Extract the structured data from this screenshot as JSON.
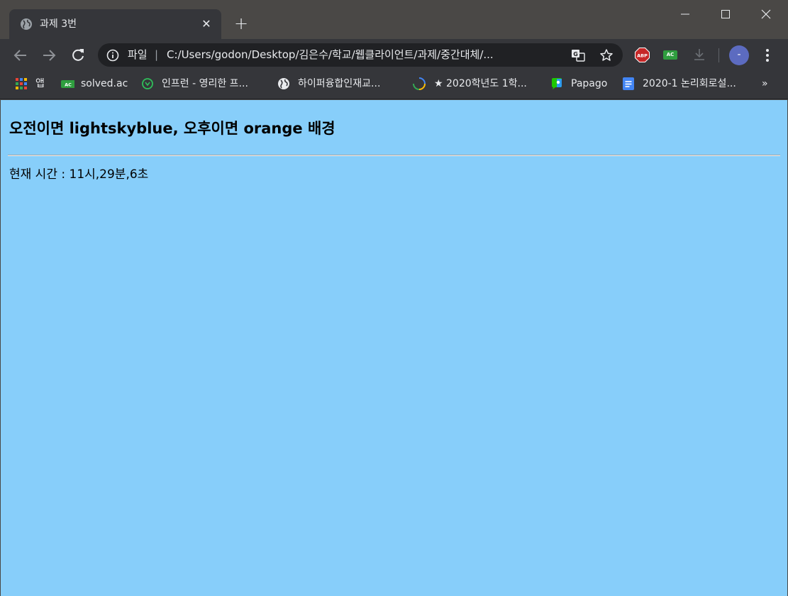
{
  "tab": {
    "title": "과제 3번",
    "close": "✕"
  },
  "new_tab_label": "+",
  "omnibox": {
    "scheme_label": "파일",
    "separator": "|",
    "url": "C:/Users/godon/Desktop/김은수/학교/웹클라이언트/과제/중간대체/..."
  },
  "extensions": {
    "ac_label": "AC",
    "abp_label": "ABP"
  },
  "avatar_label": "-",
  "bookmarks": {
    "items": [
      {
        "label": "앱",
        "icon": "apps-grid-icon"
      },
      {
        "label": "solved.ac",
        "icon": "solved-ac-icon"
      },
      {
        "label": "인프런 - 영리한 프...",
        "icon": "inflearn-icon"
      },
      {
        "label": "하이퍼융합인재교...",
        "icon": "globe-icon"
      },
      {
        "label": "★ 2020학년도 1학...",
        "icon": "spinner-icon"
      },
      {
        "label": "Papago",
        "icon": "papago-icon"
      },
      {
        "label": "2020-1 논리회로설...",
        "icon": "google-docs-icon"
      }
    ],
    "more": "»"
  },
  "page": {
    "heading": "오전이면 lightskyblue, 오후이면 orange 배경",
    "time_text": "현재 시간 : 11시,29분,6초",
    "background_color": "#87cefa"
  }
}
